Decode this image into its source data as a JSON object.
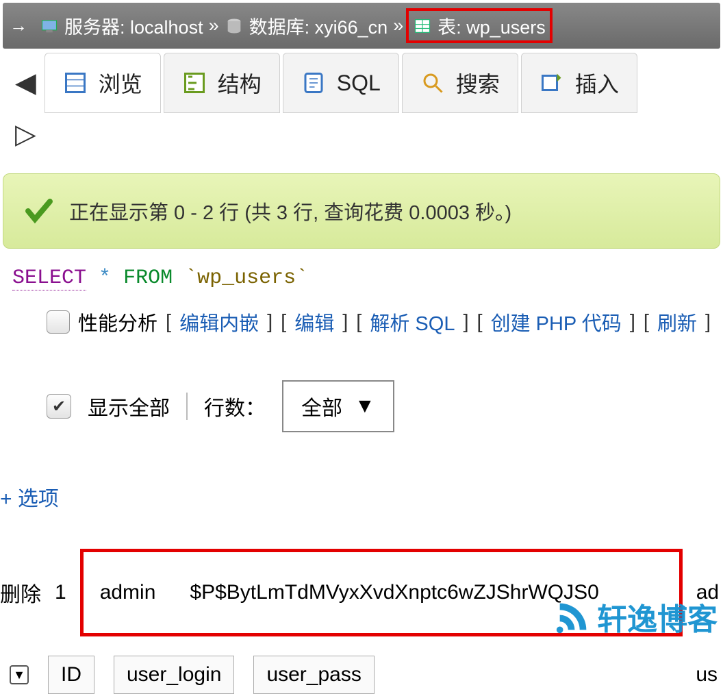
{
  "breadcrumb": {
    "server_label": "服务器: localhost",
    "database_label": "数据库: xyi66_cn",
    "table_label": "表: wp_users",
    "sep": "»"
  },
  "tabs": [
    {
      "label": "浏览"
    },
    {
      "label": "结构"
    },
    {
      "label": "SQL"
    },
    {
      "label": "搜索"
    },
    {
      "label": "插入"
    }
  ],
  "success": {
    "message": "正在显示第 0 - 2 行 (共 3 行, 查询花费 0.0003 秒。)"
  },
  "sql": {
    "select": "SELECT",
    "star": "*",
    "from": "FROM",
    "table": "`wp_users`"
  },
  "profiling": {
    "label": "性能分析",
    "edit_inline": "编辑内嵌",
    "edit": "编辑",
    "explain": "解析 SQL",
    "create_php": "创建 PHP 代码",
    "refresh": "刷新"
  },
  "showall": {
    "label": "显示全部",
    "rows_label": "行数：",
    "select_value": "全部"
  },
  "options_link": "+ 选项",
  "row": {
    "delete": "删除",
    "id": "1",
    "user_login": "admin",
    "user_pass": "$P$BytLmTdMVyxXvdXnptc6wZJShrWQJS0",
    "trailing": "ad"
  },
  "columns": {
    "id": "ID",
    "user_login": "user_login",
    "user_pass": "user_pass",
    "trailing": "us"
  },
  "watermark": {
    "text": "轩逸博客"
  }
}
